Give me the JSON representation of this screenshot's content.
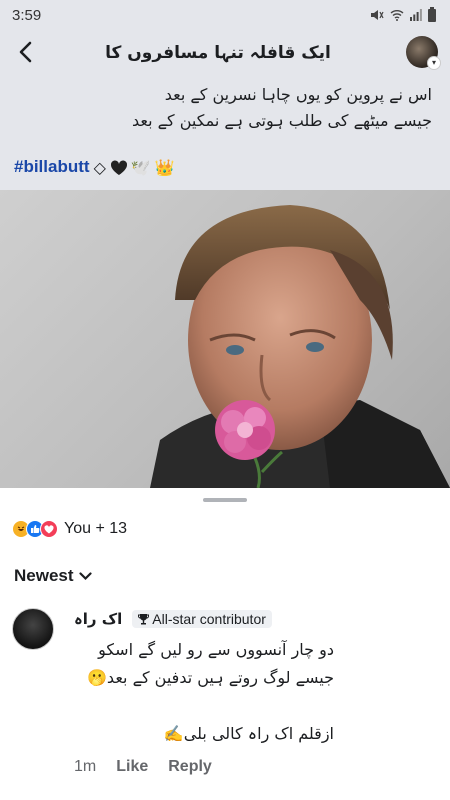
{
  "status_bar": {
    "time": "3:59"
  },
  "header": {
    "title": "ایک قافلہ تنہا مسافروں کا"
  },
  "post": {
    "lines": [
      "اس نے پروین کو یوں چاہا نسرین کے بعد",
      "جیسے میٹھے کی طلب ہوتی ہے نمکین کے بعد"
    ],
    "hashtag": "#billabutt",
    "diamond": "◇",
    "emojis": [
      "🕊️",
      "👑"
    ]
  },
  "colors": {
    "header_bg": "#e4e6eb",
    "link": "#1a47a8",
    "like": "#1877f2",
    "love": "#f33e58",
    "haha": "#f7b125"
  },
  "reactions": {
    "icons": [
      "haha-icon",
      "like-icon",
      "love-icon"
    ],
    "count": "You + 13"
  },
  "sort": {
    "label": "Newest"
  },
  "comment": {
    "author": "اک راہ",
    "badge": "All-star contributor",
    "lines": [
      "دو چار آنسووں سے رو لیں گے اسکو",
      "جیسے لوگ روتے ہیں تدفین کے بعد🫢",
      "",
      "ازقلم اک راہ کالی بلی✍️"
    ],
    "time": "1m",
    "like": "Like",
    "reply": "Reply"
  }
}
